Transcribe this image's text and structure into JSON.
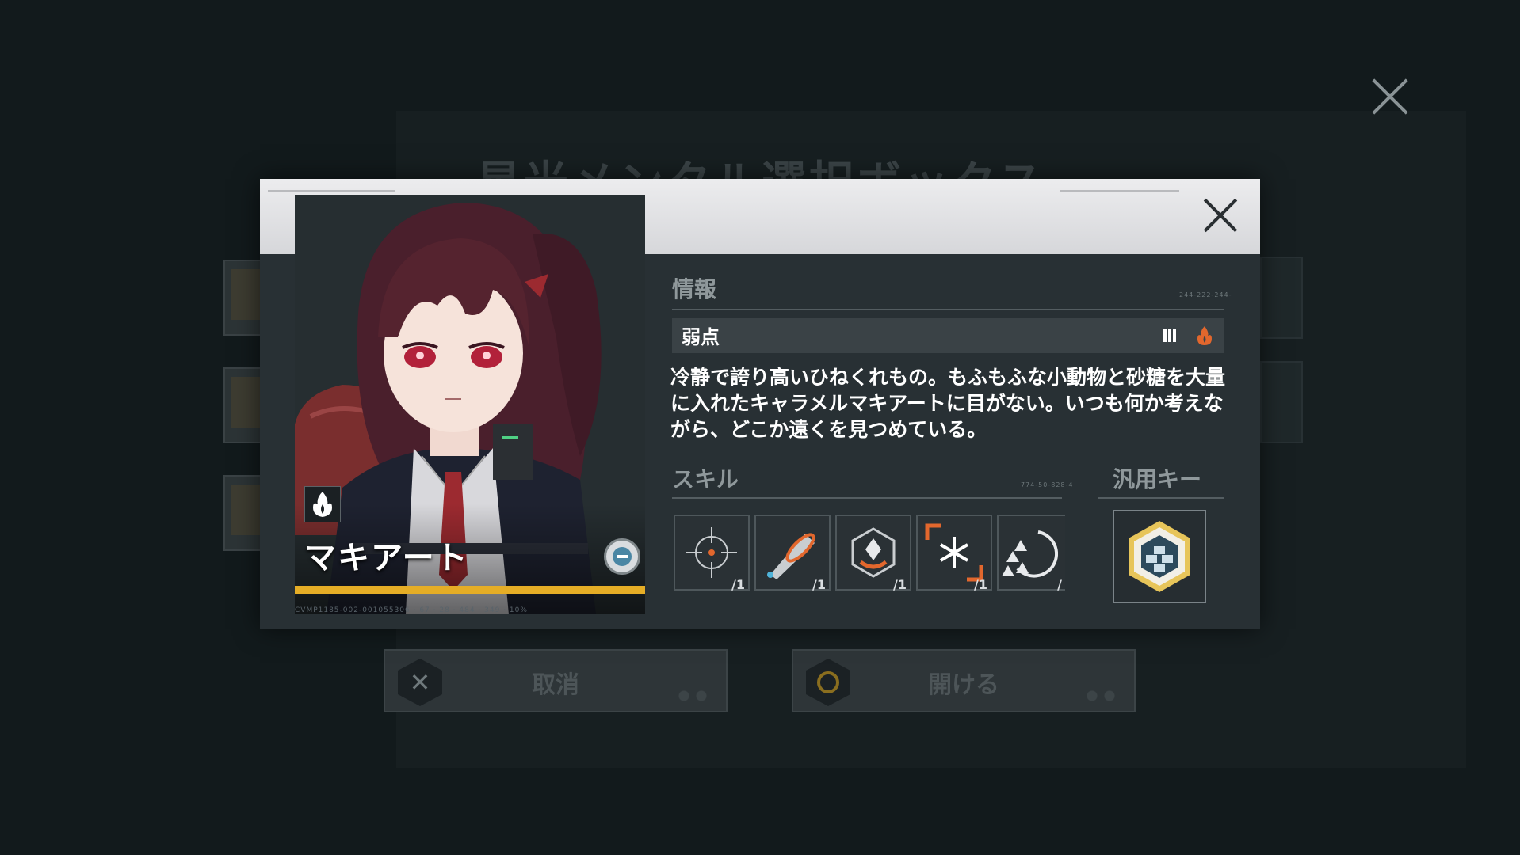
{
  "background": {
    "title": "星光メンタル選択ボックス",
    "cancel_label": "取消",
    "open_label": "開ける"
  },
  "modal": {
    "character_name": "マキアート",
    "info_title": "情報",
    "info_code": "244-222-244-",
    "weakness_label": "弱点",
    "description": "冷静で誇り高いひねくれもの。もふもふな小動物と砂糖を大量に入れたキャラメルマキアートに目がない。いつも何か考えながら、どこか遠くを見つめている。",
    "skills_title": "スキル",
    "skills_code": "774-50-828-4",
    "key_title": "汎用キー",
    "footer_code": "CVMP1185-002-001055306 · 67 · 28 · 484 · 349 · 10%",
    "skills": [
      {
        "icon": "crosshair-icon",
        "level": "/1"
      },
      {
        "icon": "bullet-icon",
        "level": "/1"
      },
      {
        "icon": "shield-hex-icon",
        "level": "/1"
      },
      {
        "icon": "snowflake-icon",
        "level": "/1"
      },
      {
        "icon": "triangle-spiral-icon",
        "level": "/"
      }
    ],
    "colors": {
      "accent_bar": "#e5ad26",
      "fire": "#e2672d",
      "element": "#4a86a4"
    }
  }
}
